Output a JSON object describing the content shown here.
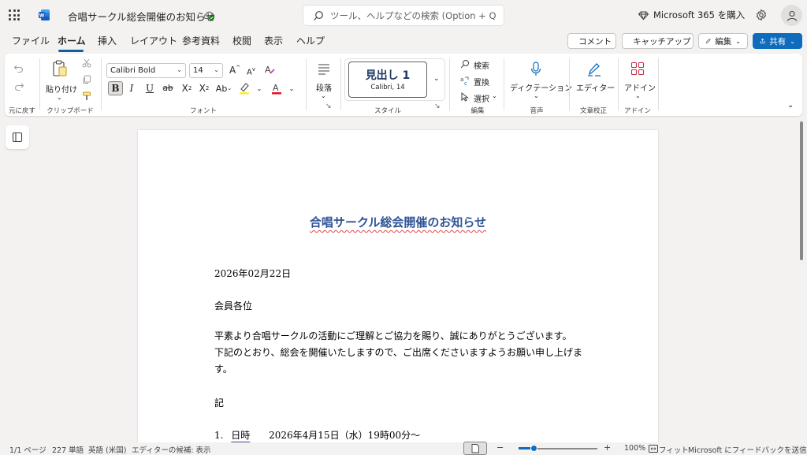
{
  "app": {
    "doc_title": "合唱サークル総会開催のお知らせ",
    "search_placeholder": "ツール、ヘルプなどの検索 (Option + Q)",
    "m365_label": "Microsoft 365 を購入"
  },
  "tabs": [
    "ファイル",
    "ホーム",
    "挿入",
    "レイアウト",
    "参考資料",
    "校閲",
    "表示",
    "ヘルプ"
  ],
  "active_tab": "ホーム",
  "title_actions": {
    "comment": "コメント",
    "catchup": "キャッチアップ",
    "edit": "編集",
    "share": "共有"
  },
  "ribbon": {
    "undo_group": "元に戻す",
    "paste": "貼り付け",
    "clipboard_group": "クリップボード",
    "font_name": "Calibri Bold",
    "font_size": "14",
    "font_group": "フォント",
    "paragraph": "段落",
    "style_name": "見出し 1",
    "style_font": "Calibri, 14",
    "style_group": "スタイル",
    "find": "検索",
    "replace": "置換",
    "select": "選択",
    "edit_group": "編集",
    "dictation": "ディクテーション",
    "voice_group": "音声",
    "editor": "エディター",
    "proofing_group": "文章校正",
    "addins": "アドイン",
    "addins_group": "アドイン"
  },
  "document": {
    "heading": "合唱サークル総会開催のお知らせ",
    "date": "2026年02月22日",
    "addressee": "会員各位",
    "body_line1": "平素より合唱サークルの活動にご理解とご協力を賜り、誠にありがとうございます。",
    "body_line2": "下記のとおり、総会を開催いたしますので、ご出席くださいますようお願い申し上げます。",
    "ki": "記",
    "item1_num": "1.",
    "item1_label": "日時",
    "item1_value": "2026年4月15日（水）19時00分～"
  },
  "status": {
    "page": "1/1 ページ",
    "words": "227 単語",
    "lang": "英語 (米国)",
    "editor": "エディターの候補: 表示",
    "zoom": "100%",
    "fit": "フィット",
    "feedback": "Microsoft にフィードバックを送信",
    "zoom_level": 0.2
  },
  "colors": {
    "accent": "#0f6cbd",
    "heading": "#2f5496"
  }
}
